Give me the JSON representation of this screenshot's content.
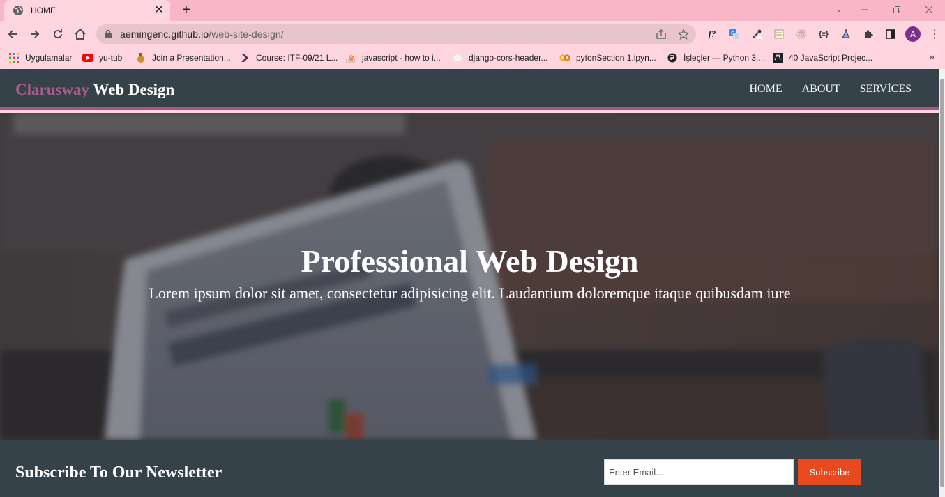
{
  "browser": {
    "tab": {
      "title": "HOME",
      "favicon": "globe-icon"
    },
    "url": {
      "host": "aemingenc.github.io",
      "path": "/web-site-design/"
    },
    "avatar_letter": "A",
    "bookmarks": [
      {
        "label": "Uygulamalar",
        "icon": "apps-grid-icon"
      },
      {
        "label": "yu-tub",
        "icon": "youtube-icon"
      },
      {
        "label": "Join a Presentation...",
        "icon": "presentation-icon"
      },
      {
        "label": "Course: ITF-09/21 L...",
        "icon": "course-icon"
      },
      {
        "label": "javascript - how to i...",
        "icon": "stackoverflow-icon"
      },
      {
        "label": "django-cors-header...",
        "icon": "package-icon"
      },
      {
        "label": "pytonSection 1.ipyn...",
        "icon": "colab-icon"
      },
      {
        "label": "İşleçler — Python 3....",
        "icon": "python-icon"
      },
      {
        "label": "40 JavaScript Projec...",
        "icon": "codepen-icon"
      }
    ]
  },
  "site": {
    "brand": {
      "highlight": "Clarusway",
      "rest": " Web Design"
    },
    "nav": [
      "HOME",
      "ABOUT",
      "SERVİCES"
    ],
    "hero": {
      "title": "Professional Web Design",
      "subtitle": "Lorem ipsum dolor sit amet, consectetur adipisicing elit. Laudantium doloremque itaque quibusdam iure"
    },
    "newsletter": {
      "title": "Subscribe To Our Newsletter",
      "email_placeholder": "Enter Email...",
      "button_label": "Subscribe"
    }
  },
  "colors": {
    "accent": "#a75686",
    "navbar": "#35424a",
    "button": "#e8491d",
    "tabbar": "#f9b6c6"
  }
}
